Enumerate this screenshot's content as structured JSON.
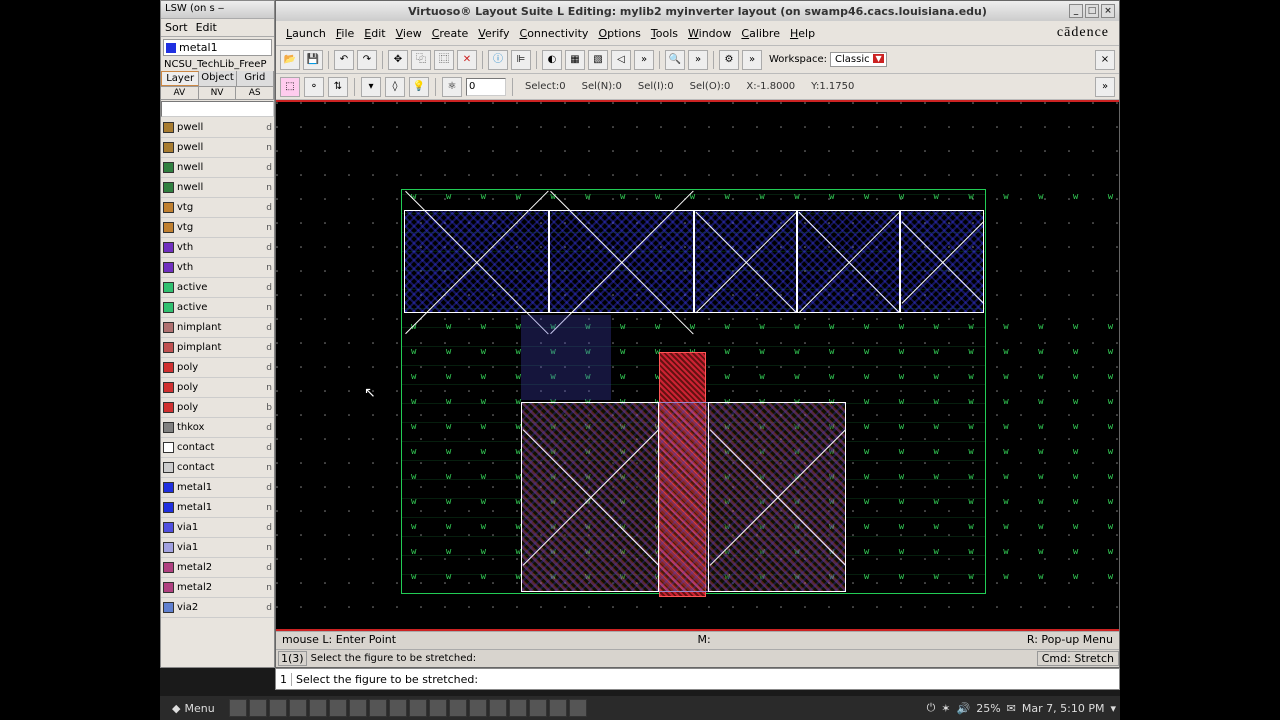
{
  "lsw": {
    "title": "LSW (on s ‒",
    "menu": [
      "Sort",
      "Edit"
    ],
    "current_layer": "metal1",
    "lib": "NCSU_TechLib_FreeP",
    "tabs": [
      "Layer",
      "Object",
      "Grid"
    ],
    "vis": [
      "AV",
      "NV",
      "AS"
    ],
    "layers": [
      {
        "n": "pwell",
        "c": "#a87c30",
        "p": "d"
      },
      {
        "n": "pwell",
        "c": "#a87c30",
        "p": "n"
      },
      {
        "n": "nwell",
        "c": "#308040",
        "p": "d"
      },
      {
        "n": "nwell",
        "c": "#308040",
        "p": "n"
      },
      {
        "n": "vtg",
        "c": "#c08030",
        "p": "d"
      },
      {
        "n": "vtg",
        "c": "#c08030",
        "p": "n"
      },
      {
        "n": "vth",
        "c": "#7030c0",
        "p": "d"
      },
      {
        "n": "vth",
        "c": "#7030c0",
        "p": "n"
      },
      {
        "n": "active",
        "c": "#30c070",
        "p": "d"
      },
      {
        "n": "active",
        "c": "#30c070",
        "p": "n"
      },
      {
        "n": "nimplant",
        "c": "#b07070",
        "p": "d"
      },
      {
        "n": "pimplant",
        "c": "#c05050",
        "p": "d"
      },
      {
        "n": "poly",
        "c": "#d03030",
        "p": "d"
      },
      {
        "n": "poly",
        "c": "#d03030",
        "p": "n"
      },
      {
        "n": "poly",
        "c": "#d03030",
        "p": "b"
      },
      {
        "n": "thkox",
        "c": "#808080",
        "p": "d"
      },
      {
        "n": "contact",
        "c": "#ffffff",
        "p": "d"
      },
      {
        "n": "contact",
        "c": "#cccccc",
        "p": "n"
      },
      {
        "n": "metal1",
        "c": "#2030e0",
        "p": "d"
      },
      {
        "n": "metal1",
        "c": "#2030e0",
        "p": "n"
      },
      {
        "n": "via1",
        "c": "#5050e0",
        "p": "d"
      },
      {
        "n": "via1",
        "c": "#a0a0e0",
        "p": "n"
      },
      {
        "n": "metal2",
        "c": "#b04080",
        "p": "d"
      },
      {
        "n": "metal2",
        "c": "#b04080",
        "p": "n"
      },
      {
        "n": "via2",
        "c": "#6080d0",
        "p": "d"
      }
    ]
  },
  "virt": {
    "title": "Virtuoso® Layout Suite L Editing: mylib2 myinverter layout (on swamp46.cacs.louisiana.edu)",
    "menus": [
      "Launch",
      "File",
      "Edit",
      "View",
      "Create",
      "Verify",
      "Connectivity",
      "Options",
      "Tools",
      "Window",
      "Calibre",
      "Help"
    ],
    "logo": "cādence",
    "workspace_label": "Workspace:",
    "workspace_value": "Classic",
    "spin_value": "0",
    "status": {
      "select": "Select:0",
      "seln": "Sel(N):0",
      "seli": "Sel(I):0",
      "selo": "Sel(O):0",
      "x": "X:-1.8000",
      "y": "Y:1.1750"
    },
    "mouse_l": "mouse L: Enter Point",
    "mouse_m": "M:",
    "mouse_r": "R: Pop-up Menu",
    "prompt_idx": "1(3)",
    "prompt": "Select the figure to be stretched:",
    "cmd": "Cmd: Stretch"
  },
  "ciw": {
    "line": "1",
    "text": "Select the figure to be stretched:"
  },
  "taskbar": {
    "menu": "Menu",
    "time": "Mar 7, 5:10 PM",
    "battery": "25%"
  }
}
